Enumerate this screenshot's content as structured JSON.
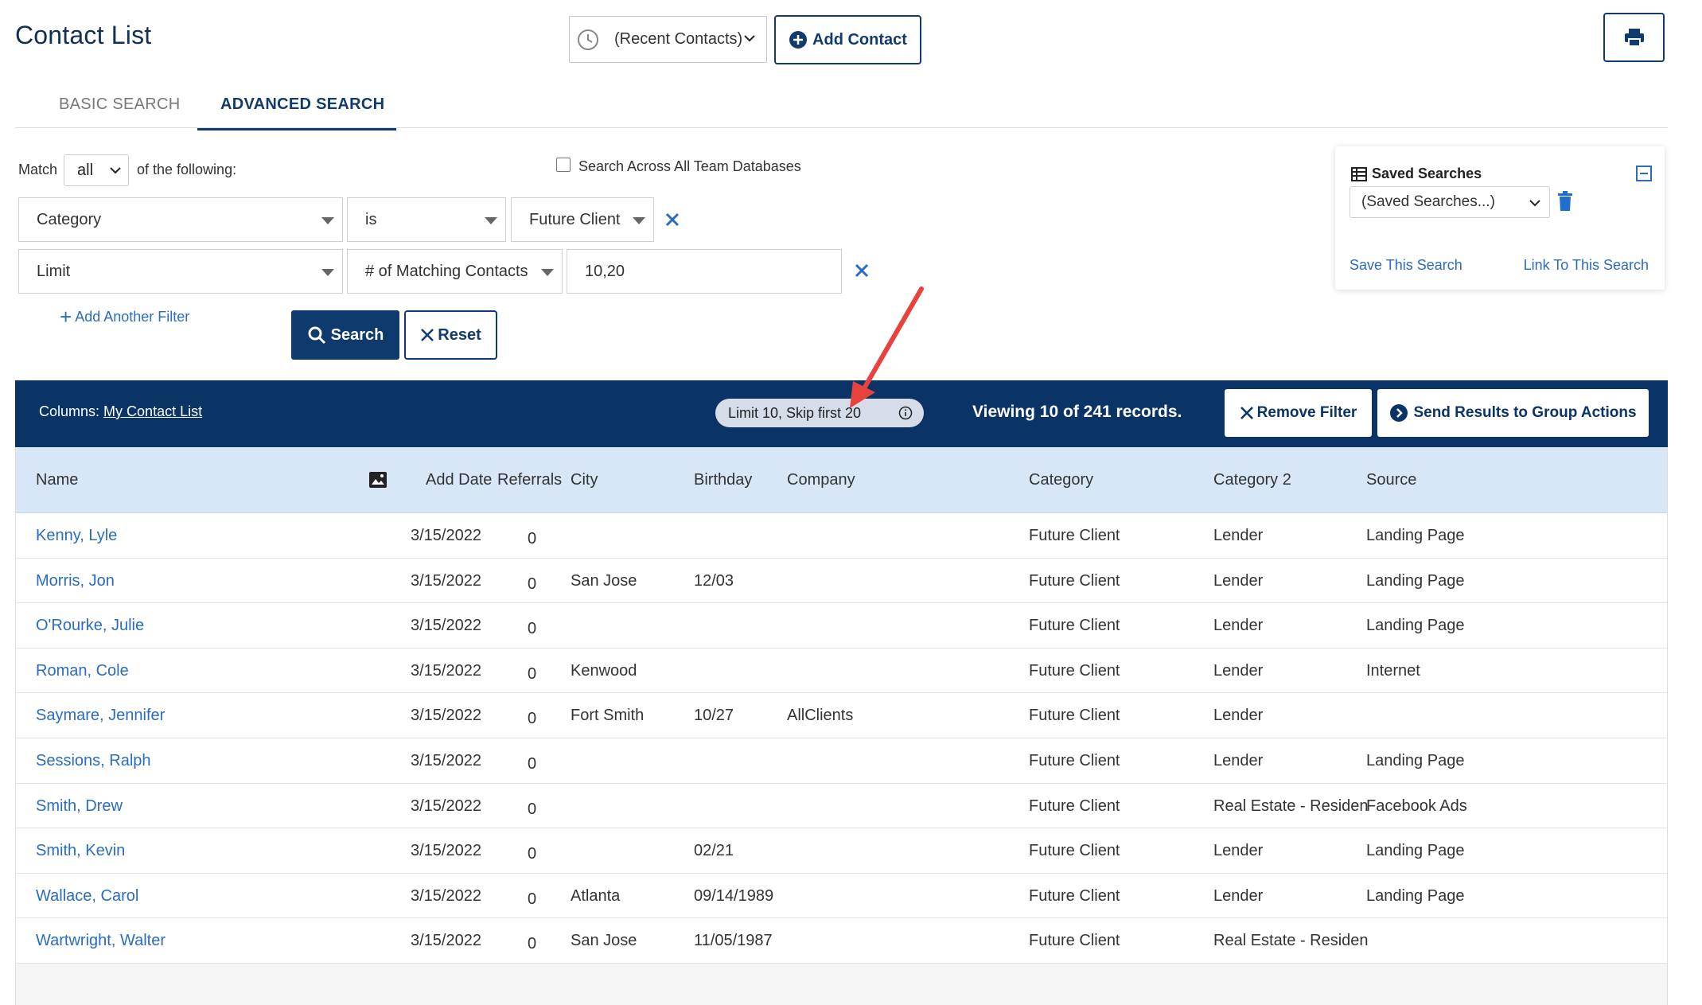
{
  "header": {
    "title": "Contact List",
    "recent_label": "(Recent Contacts)",
    "add_contact_label": "Add Contact"
  },
  "tabs": [
    {
      "label": "BASIC SEARCH",
      "active": false
    },
    {
      "label": "ADVANCED SEARCH",
      "active": true
    }
  ],
  "search": {
    "match_label": "Match",
    "match_value": "all",
    "following_label": "of the following:",
    "team_db_label": "Search Across All Team Databases",
    "filters": [
      {
        "field": "Category",
        "operator": "is",
        "value": "Future Client"
      },
      {
        "field": "Limit",
        "operator": "# of Matching Contacts",
        "value": "10,20"
      }
    ],
    "add_filter_label": "Add Another Filter",
    "search_label": "Search",
    "reset_label": "Reset"
  },
  "saved": {
    "title": "Saved Searches",
    "select_value": "(Saved Searches...)",
    "save_link": "Save This Search",
    "link_link": "Link To This Search"
  },
  "results": {
    "columns_label": "Columns:",
    "columns_link": "My Contact List",
    "limit_pill": "Limit 10, Skip first 20",
    "viewing": "Viewing 10 of 241 records.",
    "remove_filter_label": "Remove Filter",
    "group_actions_label": "Send Results to Group Actions"
  },
  "table": {
    "headers": {
      "name": "Name",
      "add_date": "Add Date",
      "referrals": "Referrals",
      "city": "City",
      "birthday": "Birthday",
      "company": "Company",
      "category": "Category",
      "category2": "Category 2",
      "source": "Source"
    },
    "rows": [
      {
        "name": "Kenny, Lyle",
        "add_date": "3/15/2022",
        "referrals": "0",
        "city": "",
        "birthday": "",
        "company": "",
        "category": "Future Client",
        "category2": "Lender",
        "source": "Landing Page"
      },
      {
        "name": "Morris, Jon",
        "add_date": "3/15/2022",
        "referrals": "0",
        "city": "San Jose",
        "birthday": "12/03",
        "company": "",
        "category": "Future Client",
        "category2": "Lender",
        "source": "Landing Page"
      },
      {
        "name": "O'Rourke, Julie",
        "add_date": "3/15/2022",
        "referrals": "0",
        "city": "",
        "birthday": "",
        "company": "",
        "category": "Future Client",
        "category2": "Lender",
        "source": "Landing Page"
      },
      {
        "name": "Roman, Cole",
        "add_date": "3/15/2022",
        "referrals": "0",
        "city": "Kenwood",
        "birthday": "",
        "company": "",
        "category": "Future Client",
        "category2": "Lender",
        "source": "Internet"
      },
      {
        "name": "Saymare, Jennifer",
        "add_date": "3/15/2022",
        "referrals": "0",
        "city": "Fort Smith",
        "birthday": "10/27",
        "company": "AllClients",
        "category": "Future Client",
        "category2": "Lender",
        "source": ""
      },
      {
        "name": "Sessions, Ralph",
        "add_date": "3/15/2022",
        "referrals": "0",
        "city": "",
        "birthday": "",
        "company": "",
        "category": "Future Client",
        "category2": "Lender",
        "source": "Landing Page"
      },
      {
        "name": "Smith, Drew",
        "add_date": "3/15/2022",
        "referrals": "0",
        "city": "",
        "birthday": "",
        "company": "",
        "category": "Future Client",
        "category2": "Real Estate - Residen",
        "source": "Facebook Ads"
      },
      {
        "name": "Smith, Kevin",
        "add_date": "3/15/2022",
        "referrals": "0",
        "city": "",
        "birthday": "02/21",
        "company": "",
        "category": "Future Client",
        "category2": "Lender",
        "source": "Landing Page"
      },
      {
        "name": "Wallace, Carol",
        "add_date": "3/15/2022",
        "referrals": "0",
        "city": "Atlanta",
        "birthday": "09/14/1989",
        "company": "",
        "category": "Future Client",
        "category2": "Lender",
        "source": "Landing Page"
      },
      {
        "name": "Wartwright, Walter",
        "add_date": "3/15/2022",
        "referrals": "0",
        "city": "San Jose",
        "birthday": "11/05/1987",
        "company": "",
        "category": "Future Client",
        "category2": "Real Estate - Residen",
        "source": ""
      }
    ]
  },
  "colors": {
    "navy": "#0b3466",
    "link": "#2a6cc0",
    "header_row": "#d8e7f8",
    "annotation_arrow": "#e8423f"
  },
  "icons": {
    "clock": "clock-icon",
    "plus_circle": "plus-circle-icon",
    "printer": "printer-icon",
    "close": "close-icon",
    "search": "search-icon",
    "table": "table-icon",
    "trash": "trash-icon",
    "collapse": "collapse-icon",
    "info": "info-icon",
    "arrow_right_circle": "arrow-right-circle-icon",
    "image": "image-icon"
  }
}
